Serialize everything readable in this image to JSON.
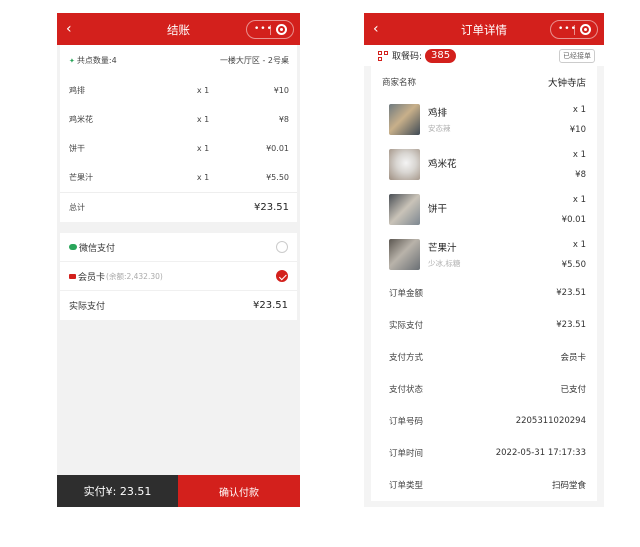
{
  "checkout": {
    "nav": {
      "back": "‹",
      "title": "结账"
    },
    "summary": {
      "count_label": "共点数量:4",
      "table": "一楼大厅区 - 2号桌"
    },
    "items": [
      {
        "name": "鸡排",
        "qty": "x 1",
        "price": "¥10"
      },
      {
        "name": "鸡米花",
        "qty": "x 1",
        "price": "¥8"
      },
      {
        "name": "饼干",
        "qty": "x 1",
        "price": "¥0.01"
      },
      {
        "name": "芒果汁",
        "qty": "x 1",
        "price": "¥5.50"
      }
    ],
    "total": {
      "label": "总计",
      "value": "¥23.51"
    },
    "payment": {
      "wechat": "微信支付",
      "member": "会员卡",
      "balance": "(余额:2,432.30)",
      "actual_label": "实际支付",
      "actual_value": "¥23.51"
    },
    "bottom": {
      "paid": "实付¥: 23.51",
      "confirm": "确认付款"
    }
  },
  "detail": {
    "nav": {
      "back": "‹",
      "title": "订单详情"
    },
    "pickup": {
      "label": "取餐码:",
      "code": "385",
      "badge": "已经接单"
    },
    "shop": {
      "label": "商家名称",
      "value": "大钟寺店"
    },
    "items": [
      {
        "name": "鸡排",
        "spec": "安态辣",
        "qty": "x 1",
        "price": "¥10"
      },
      {
        "name": "鸡米花",
        "spec": "",
        "qty": "x 1",
        "price": "¥8"
      },
      {
        "name": "饼干",
        "spec": "",
        "qty": "x 1",
        "price": "¥0.01"
      },
      {
        "name": "芒果汁",
        "spec": "少冰,标糖",
        "qty": "x 1",
        "price": "¥5.50"
      }
    ],
    "fields": [
      {
        "label": "订单金额",
        "value": "¥23.51"
      },
      {
        "label": "实际支付",
        "value": "¥23.51"
      },
      {
        "label": "支付方式",
        "value": "会员卡"
      },
      {
        "label": "支付状态",
        "value": "已支付"
      },
      {
        "label": "订单号码",
        "value": "2205311020294"
      },
      {
        "label": "订单时间",
        "value": "2022-05-31 17:17:33"
      },
      {
        "label": "订单类型",
        "value": "扫码堂食"
      }
    ]
  },
  "colors": {
    "brand_red": "#d3201c",
    "dark_bar": "#2e2e2e",
    "wechat_green": "#2aa55a"
  }
}
